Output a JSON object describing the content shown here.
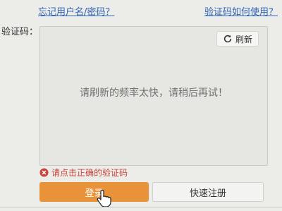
{
  "links": {
    "forgot": "忘记用户名/密码？",
    "howto": "验证码如何使用？"
  },
  "captcha": {
    "label": "验证码：",
    "refresh_label": "刷新",
    "refresh_icon": "refresh-icon",
    "message": "请刷新的频率太快，请稍后再试！"
  },
  "error": {
    "text": "请点击正确的验证码",
    "icon": "error-circle-icon",
    "color": "#c9453b"
  },
  "buttons": {
    "login_label": "登录",
    "login_color": "#e8923a",
    "register_label": "快速注册"
  }
}
